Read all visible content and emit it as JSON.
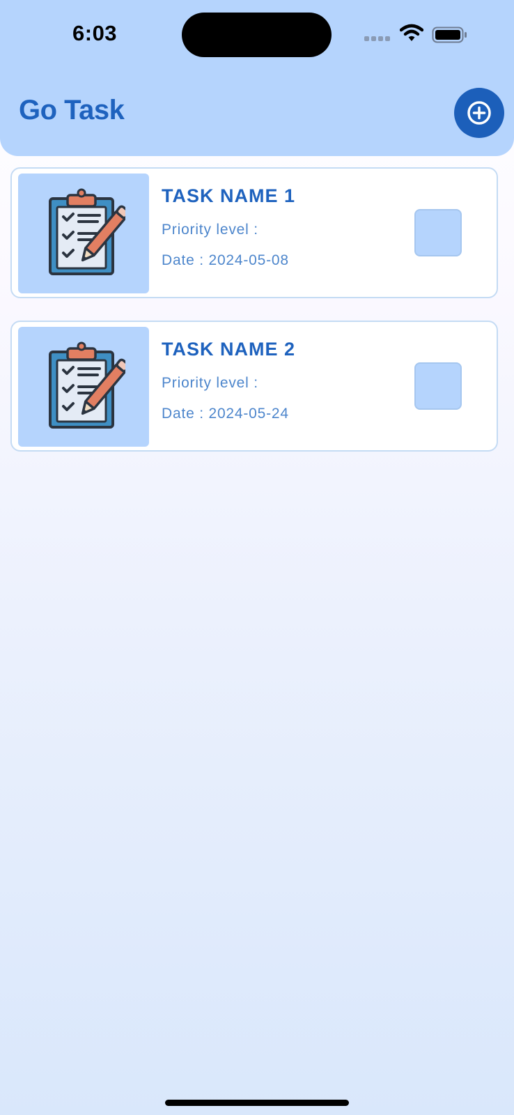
{
  "status_bar": {
    "time": "6:03",
    "icons": [
      "signal-icon",
      "wifi-icon",
      "battery-icon"
    ]
  },
  "header": {
    "title": "Go Task",
    "add_icon": "plus-circle-icon"
  },
  "tasks": [
    {
      "name": "TASK NAME 1",
      "priority": "Priority level :",
      "date": "Date : 2024-05-08",
      "icon": "clipboard-checklist-icon",
      "checked": false
    },
    {
      "name": "TASK NAME 2",
      "priority": "Priority level :",
      "date": "Date : 2024-05-24",
      "icon": "clipboard-checklist-icon",
      "checked": false
    }
  ],
  "colors": {
    "header_bg": "#b5d4fd",
    "accent": "#1e62be",
    "button_bg": "#1c5fba",
    "secondary_text": "#4d86cc",
    "card_border": "#c4dbf4"
  }
}
